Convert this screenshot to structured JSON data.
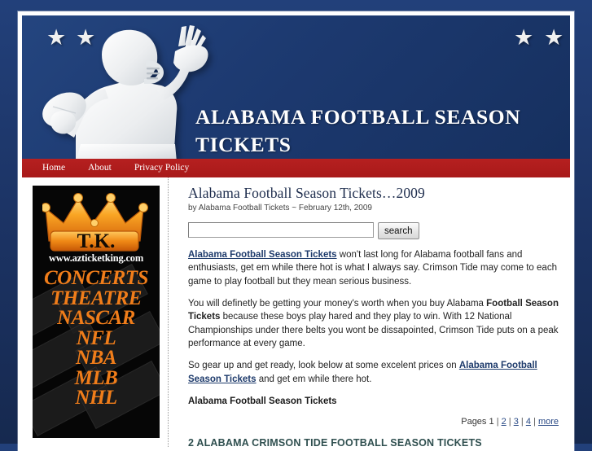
{
  "colors": {
    "page_bg": "#1f3a6e",
    "header_blue": "#1c3a72",
    "nav_red": "#ad1c1c",
    "link_blue": "#1d3a6b",
    "result_heading": "#2f4f4f",
    "ad_bg": "#060606",
    "ad_orange": "#f07d1a"
  },
  "header": {
    "site_title": "Alabama Football Season Tickets",
    "stars": [
      "star-icon",
      "star-icon",
      "star-icon",
      "star-icon"
    ],
    "banner_image": "football-quarterback-silhouette"
  },
  "nav": {
    "items": [
      {
        "label": "Home"
      },
      {
        "label": "About"
      },
      {
        "label": "Privacy Policy"
      }
    ]
  },
  "sidebar": {
    "ad": {
      "logo": "crown-icon",
      "logo_text": "T.K.",
      "url": "www.azticketking.com",
      "categories": [
        "CONCERTS",
        "THEATRE",
        "NASCAR",
        "NFL",
        "NBA",
        "MLB",
        "NHL"
      ]
    }
  },
  "main": {
    "post_title": "Alabama Football Season Tickets…2009",
    "post_meta": "by Alabama Football Tickets ~ February 12th, 2009",
    "search": {
      "value": "",
      "placeholder": "",
      "button_label": "search"
    },
    "paragraph1": {
      "link": "Alabama Football Season Tickets",
      "rest": " won't last long for Alabama football fans and enthusiasts, get em while there hot is what I always say. Crimson Tide may come to each game to play football but they mean serious business."
    },
    "paragraph2": {
      "part1": "You will definetly be getting your money's worth when you buy Alabama ",
      "bold": "Football Season Tickets",
      "part2": " because these boys play hared and they play to win. With 12 National Championships under there belts you wont be dissapointed, Crimson Tide puts on a peak performance at every game."
    },
    "paragraph3": {
      "part1": "So gear up and get ready, look below at some excelent prices on ",
      "link": "Alabama Football Season Tickets",
      "part2": " and get em while there hot."
    },
    "sub_heading": "Alabama Football Season Tickets",
    "pages": {
      "label": "Pages",
      "current": "1",
      "links": [
        "2",
        "3",
        "4",
        "more"
      ],
      "separator": "|"
    },
    "result_heading": "2 ALABAMA CRIMSON TIDE FOOTBALL SEASON TICKETS"
  }
}
